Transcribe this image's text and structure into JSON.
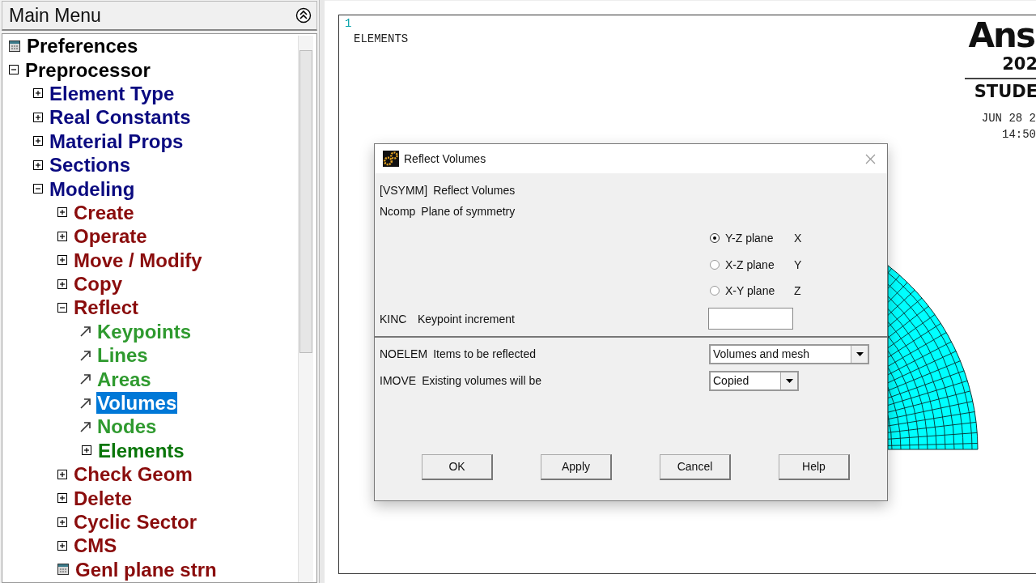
{
  "main_menu": {
    "title": "Main Menu",
    "items": [
      {
        "label": "Preferences",
        "kind": "panel",
        "selected": false
      },
      {
        "label": "Preprocessor",
        "kind": "folder",
        "expanded": true,
        "selected": false,
        "children": [
          {
            "label": "Element Type",
            "kind": "folder",
            "expanded": false,
            "selected": false
          },
          {
            "label": "Real Constants",
            "kind": "folder",
            "expanded": false,
            "selected": false
          },
          {
            "label": "Material Props",
            "kind": "folder",
            "expanded": false,
            "selected": false
          },
          {
            "label": "Sections",
            "kind": "folder",
            "expanded": false,
            "selected": false
          },
          {
            "label": "Modeling",
            "kind": "folder",
            "expanded": true,
            "selected": false,
            "children": [
              {
                "label": "Create",
                "kind": "folder",
                "expanded": false,
                "selected": false
              },
              {
                "label": "Operate",
                "kind": "folder",
                "expanded": false,
                "selected": false
              },
              {
                "label": "Move / Modify",
                "kind": "folder",
                "expanded": false,
                "selected": false
              },
              {
                "label": "Copy",
                "kind": "folder",
                "expanded": false,
                "selected": false
              },
              {
                "label": "Reflect",
                "kind": "folder",
                "expanded": true,
                "selected": false,
                "children": [
                  {
                    "label": "Keypoints",
                    "kind": "action",
                    "selected": false
                  },
                  {
                    "label": "Lines",
                    "kind": "action",
                    "selected": false
                  },
                  {
                    "label": "Areas",
                    "kind": "action",
                    "selected": false
                  },
                  {
                    "label": "Volumes",
                    "kind": "action",
                    "selected": true
                  },
                  {
                    "label": "Nodes",
                    "kind": "action",
                    "selected": false
                  },
                  {
                    "label": "Elements",
                    "kind": "folder",
                    "expanded": false,
                    "selected": false
                  }
                ]
              },
              {
                "label": "Check Geom",
                "kind": "folder",
                "expanded": false,
                "selected": false
              },
              {
                "label": "Delete",
                "kind": "folder",
                "expanded": false,
                "selected": false
              },
              {
                "label": "Cyclic Sector",
                "kind": "folder",
                "expanded": false,
                "selected": false
              },
              {
                "label": "CMS",
                "kind": "folder",
                "expanded": false,
                "selected": false
              },
              {
                "label": "Genl plane strn",
                "kind": "panel",
                "selected": false
              }
            ]
          }
        ]
      }
    ]
  },
  "graphics": {
    "window_number": "1",
    "plot_label": "ELEMENTS",
    "logo": "Ans",
    "version": "202",
    "edition": "STUDE",
    "date": "JUN 28 2",
    "time": "14:50"
  },
  "dialog": {
    "title": "Reflect Volumes",
    "heading": {
      "code": "[VSYMM]",
      "text": "Reflect Volumes"
    },
    "ncomp": {
      "code": "Ncomp",
      "label": "Plane of symmetry",
      "options": [
        {
          "label": "Y-Z plane",
          "axis": "X",
          "selected": true
        },
        {
          "label": "X-Z plane",
          "axis": "Y",
          "selected": false
        },
        {
          "label": "X-Y plane",
          "axis": "Z",
          "selected": false
        }
      ]
    },
    "kinc": {
      "code": "KINC",
      "label": "Keypoint increment"
    },
    "noelem": {
      "code": "NOELEM",
      "label": "Items to be reflected",
      "value": "Volumes and mesh"
    },
    "imove": {
      "code": "IMOVE",
      "label": "Existing volumes will be",
      "value": "Copied"
    },
    "buttons": [
      "OK",
      "Apply",
      "Cancel",
      "Help"
    ]
  }
}
